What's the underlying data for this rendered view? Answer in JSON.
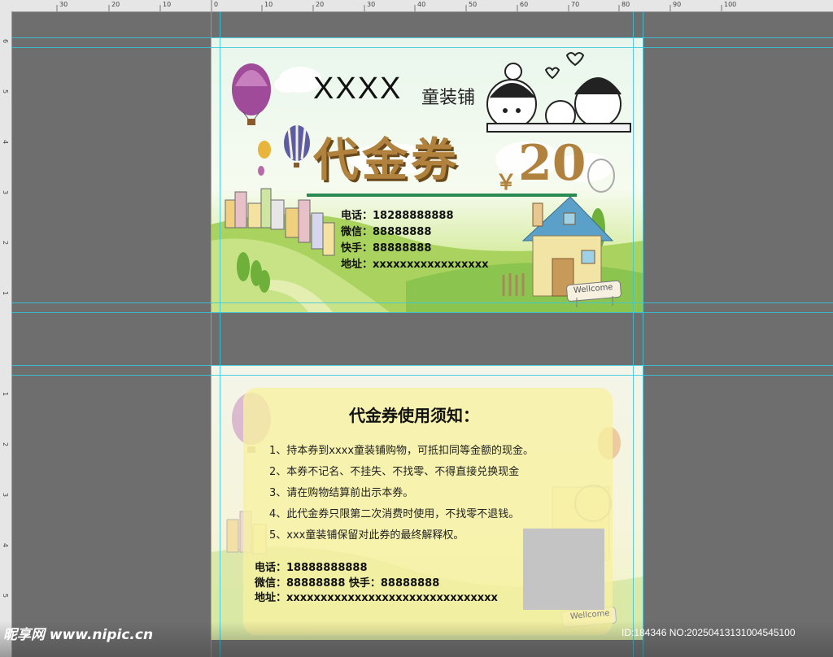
{
  "ruler": {
    "top_labels": [
      "30",
      "20",
      "10",
      "0",
      "10",
      "20",
      "30",
      "40",
      "50",
      "60",
      "70",
      "80",
      "90",
      "100"
    ],
    "left_labels": [
      "6",
      "5",
      "4",
      "3",
      "2",
      "1",
      "1",
      "2",
      "3",
      "4",
      "5"
    ]
  },
  "front": {
    "shop_name": "XXXX",
    "shop_type": "童装铺",
    "title": "代金券",
    "currency": "￥",
    "amount": "20",
    "contacts": [
      {
        "label": "电话：",
        "value": "18288888888"
      },
      {
        "label": "微信：",
        "value": "88888888"
      },
      {
        "label": "快手：",
        "value": "88888888"
      },
      {
        "label": "地址：",
        "value": "xxxxxxxxxxxxxxxxx"
      }
    ],
    "sign_text": "Wellcome"
  },
  "back": {
    "notice_title": "代金券使用须知：",
    "rules": [
      "1、持本券到xxxx童装铺购物，可抵扣同等金额的现金。",
      "2、本券不记名、不挂失、不找零、不得直接兑换现金",
      "3、请在购物结算前出示本券。",
      "4、此代金券只限第二次消费时使用，不找零不退钱。",
      "5、xxx童装铺保留对此券的最终解释权。"
    ],
    "phone_line": "电话：18888888888",
    "wechat_line": "微信：88888888   快手：88888888",
    "address_line": "地址：xxxxxxxxxxxxxxxxxxxxxxxxxxxxxxx",
    "sign_text": "Wellcome"
  },
  "watermark": {
    "site": "昵享网 www.nipic.cn",
    "id": "ID:184346 NO:20250413131004545100"
  },
  "colors": {
    "canvas_bg": "#6e6e6e",
    "guide": "#35c8e0",
    "title_gold": "#b0823e",
    "accent_green": "#2a8a52"
  }
}
